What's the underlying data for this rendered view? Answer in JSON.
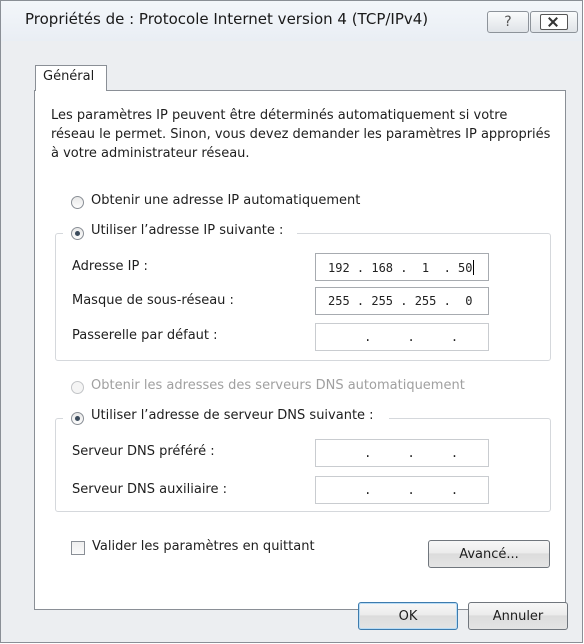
{
  "window": {
    "title": "Propriétés de : Protocole Internet version 4 (TCP/IPv4)",
    "help_glyph": "?"
  },
  "tabs": [
    {
      "label": "Général",
      "selected": true
    }
  ],
  "description": "Les paramètres IP peuvent être déterminés automatiquement si votre réseau le permet. Sinon, vous devez demander les paramètres IP appropriés à votre administrateur réseau.",
  "ip_section": {
    "auto_label": "Obtenir une adresse IP automatiquement",
    "manual_label": "Utiliser l’adresse IP suivante :",
    "selected": "manual",
    "fields": [
      {
        "label": "Adresse IP :",
        "value": "192 . 168 .  1  . 50"
      },
      {
        "label": "Masque de sous-réseau :",
        "value": "255 . 255 . 255 .  0"
      },
      {
        "label": "Passerelle par défaut :",
        "value": "     .     .     ."
      }
    ]
  },
  "dns_section": {
    "auto_label": "Obtenir les adresses des serveurs DNS automatiquement",
    "auto_disabled": true,
    "manual_label": "Utiliser l’adresse de serveur DNS suivante :",
    "selected": "manual",
    "fields": [
      {
        "label": "Serveur DNS préféré :",
        "value": "     .     .     ."
      },
      {
        "label": "Serveur DNS auxiliaire :",
        "value": "     .     .     ."
      }
    ]
  },
  "validate_checkbox": {
    "label": "Valider les paramètres en quittant",
    "checked": false
  },
  "buttons": {
    "advanced": "Avancé...",
    "ok": "OK",
    "cancel": "Annuler"
  },
  "colors": {
    "window_bg": "#eceef1",
    "border": "#8a8f96",
    "disabled_text": "#a0a0a0"
  }
}
